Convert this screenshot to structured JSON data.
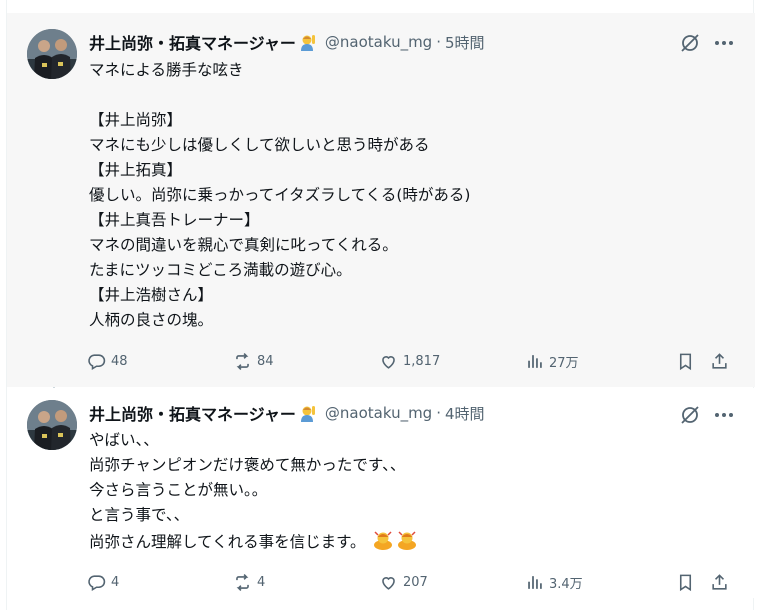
{
  "tweets": [
    {
      "author_name": "井上尚弥・拓真マネージャー",
      "author_emoji": "person-raising-hand-emoji",
      "handle": "@naotaku_mg",
      "separator": "·",
      "time": "5時間",
      "text": "マネによる勝手な呟き\n\n【井上尚弥】\nマネにも少しは優しくして欲しいと思う時がある\n【井上拓真】\n優しい。尚弥に乗っかってイタズラしてくる(時がある)\n【井上真吾トレーナー】\nマネの間違いを親心で真剣に叱ってくれる。\nたまにツッコミどころ満載の遊び心。\n【井上浩樹さん】\n人柄の良さの塊。",
      "replies": "48",
      "reposts": "84",
      "likes": "1,817",
      "views": "27万"
    },
    {
      "author_name": "井上尚弥・拓真マネージャー",
      "author_emoji": "person-raising-hand-emoji",
      "handle": "@naotaku_mg",
      "separator": "·",
      "time": "4時間",
      "text": "やばい、、\n尚弥チャンピオンだけ褒めて無かったです、、\n今さら言うことが無い。。\nと言う事で、、\n尚弥さん理解してくれる事を信じます。",
      "text_emojis": [
        "person-bowing-emoji",
        "person-bowing-emoji"
      ],
      "replies": "4",
      "reposts": "4",
      "likes": "207",
      "views": "3.4万"
    }
  ],
  "icons": {
    "grok": "grok-slash-icon",
    "more": "more-dots-icon",
    "reply": "reply-bubble-icon",
    "repost": "repost-arrows-icon",
    "like": "heart-icon",
    "views": "bar-chart-icon",
    "bookmark": "bookmark-icon",
    "share": "share-upload-icon"
  },
  "colors": {
    "text": "#0f1419",
    "secondary": "#536471",
    "thread_line": "#cfd9de",
    "highlight_bg": "#f7f7f7"
  }
}
